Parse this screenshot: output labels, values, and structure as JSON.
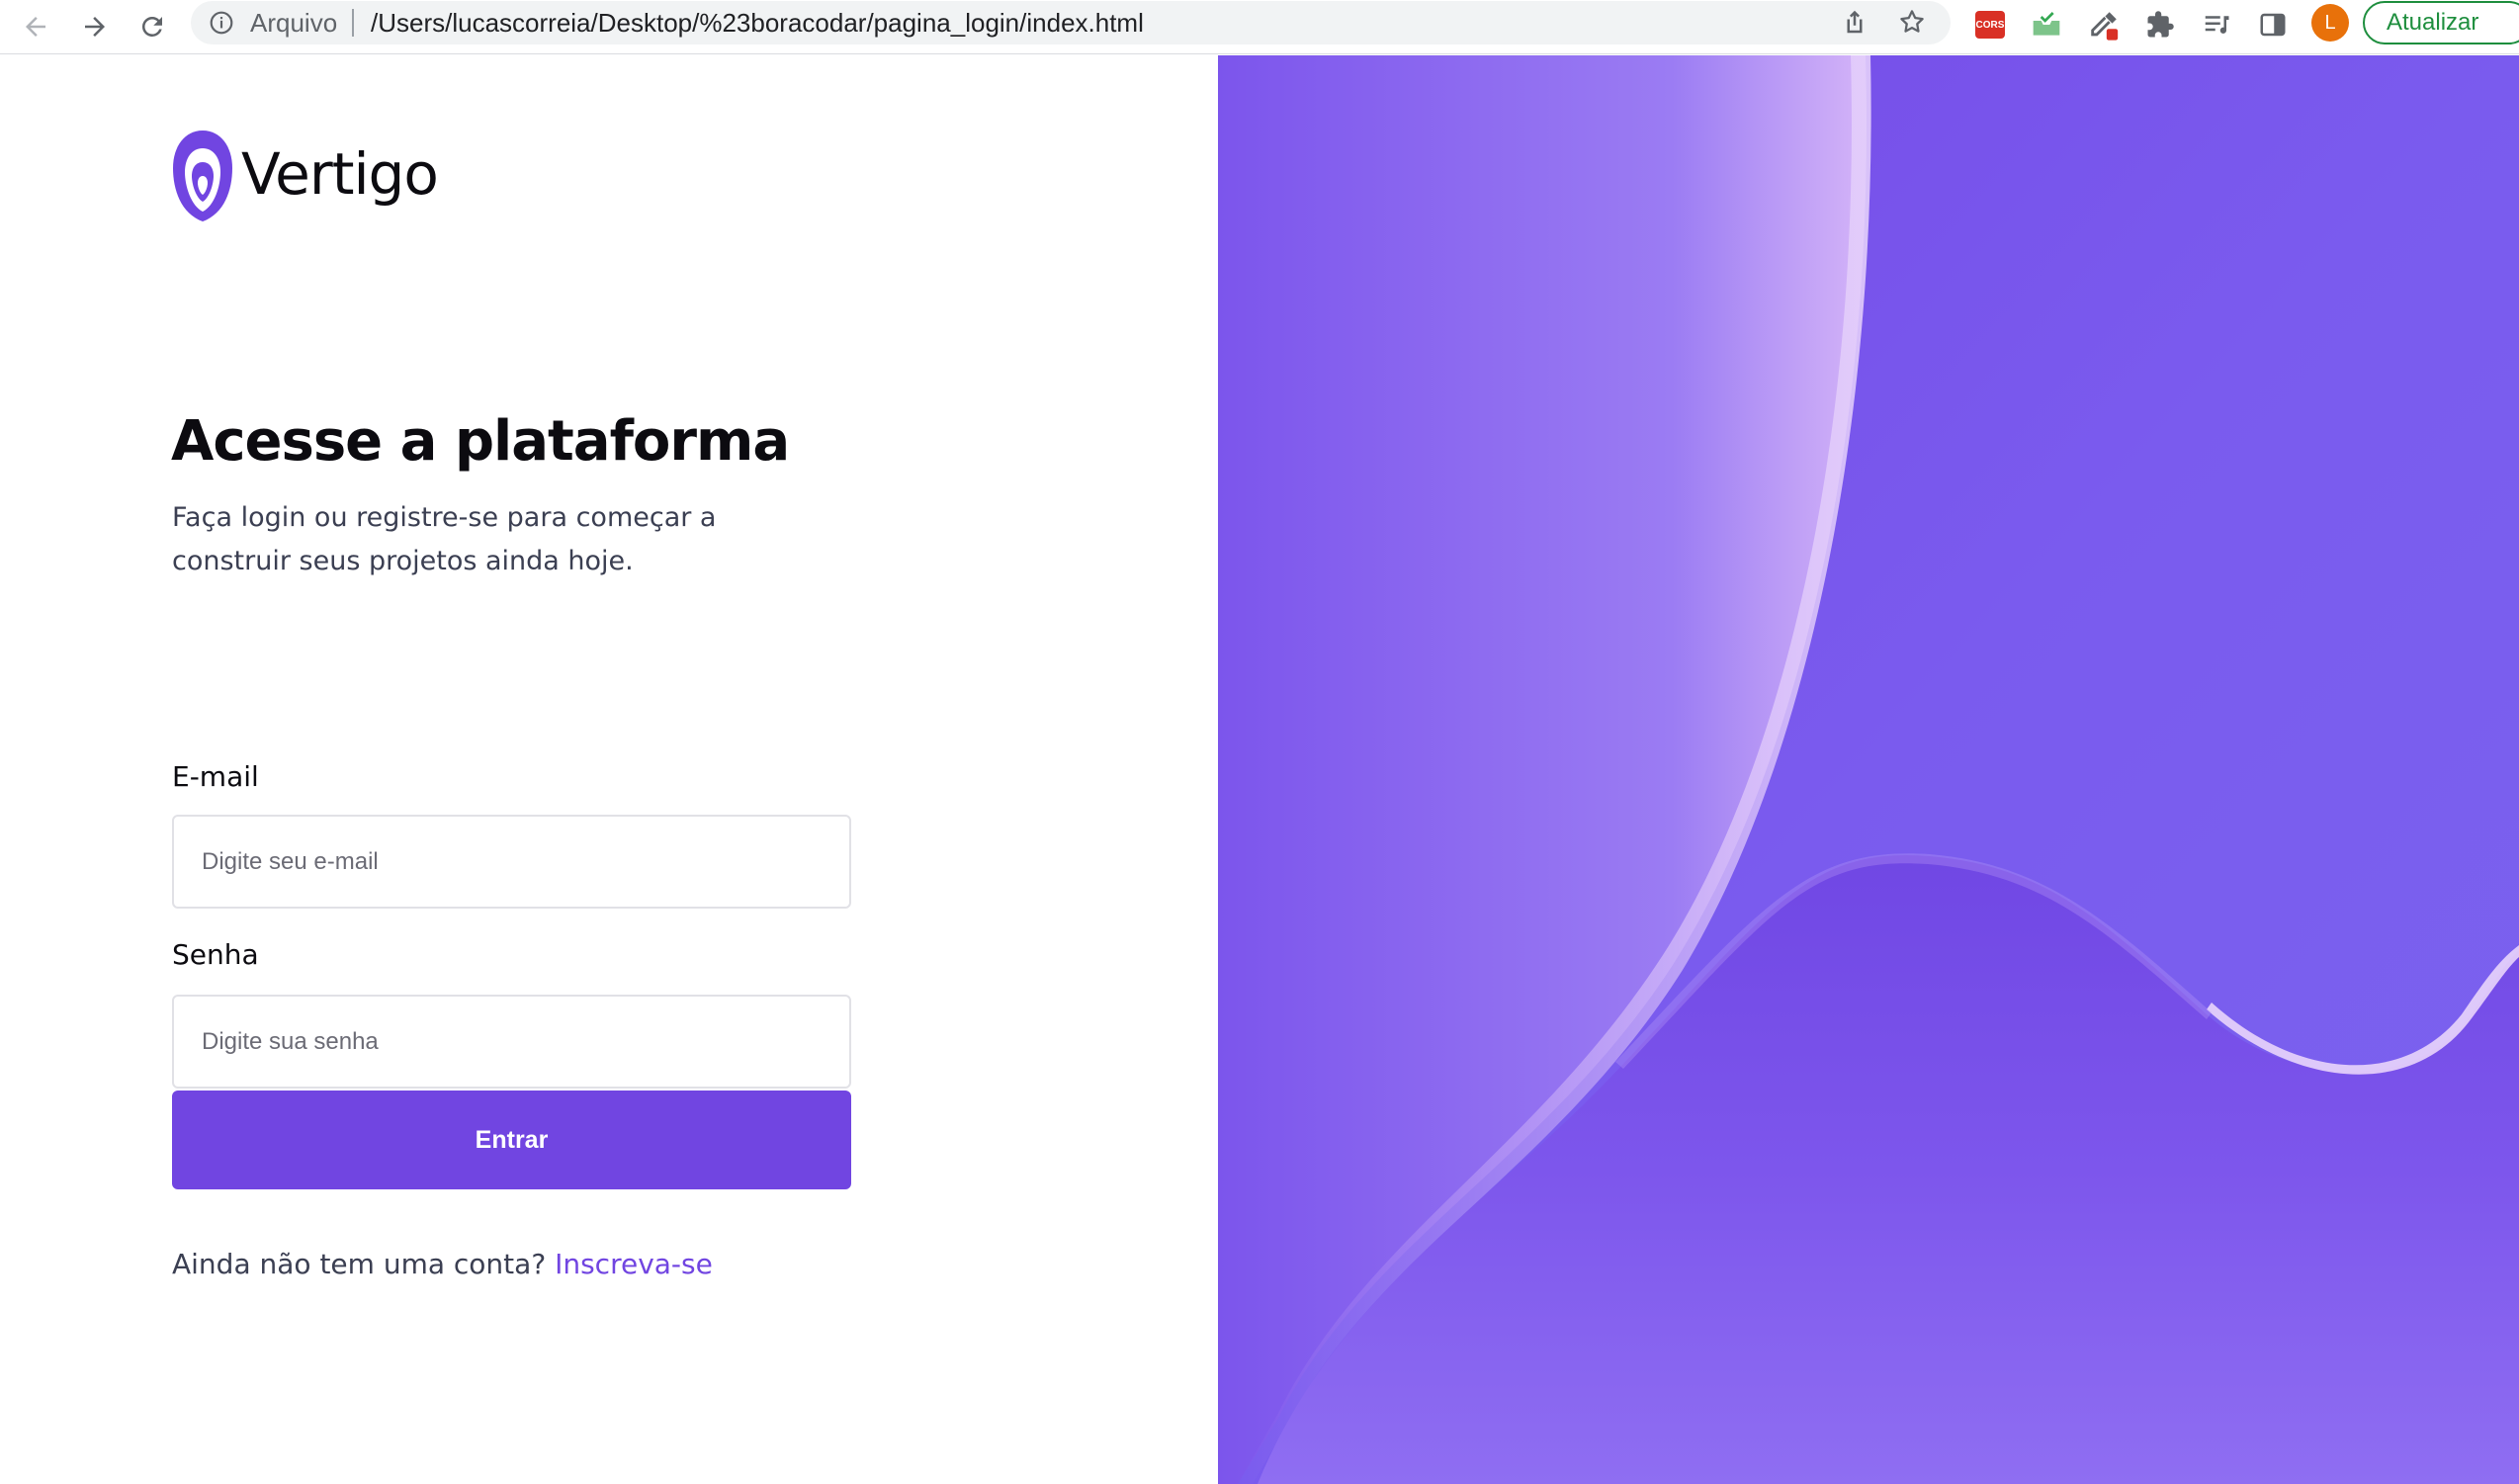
{
  "browser": {
    "scheme_label": "Arquivo",
    "url": "/Users/lucascorreia/Desktop/%23boracodar/pagina_login/index.html",
    "update_label": "Atualizar",
    "avatar_initial": "L",
    "extensions": [
      "cors-extension-icon",
      "inbox-check-extension-icon",
      "eyedropper-extension-icon",
      "puzzle-extensions-icon",
      "reading-list-icon",
      "side-panel-icon"
    ],
    "cors_badge_text": "CORS"
  },
  "brand": {
    "name": "Vertigo",
    "logo_color": "#7145e1"
  },
  "login": {
    "heading": "Acesse a plataforma",
    "subtitle": "Faça login ou registre-se para começar a construir seus projetos ainda hoje.",
    "email_label": "E-mail",
    "email_placeholder": "Digite seu e-mail",
    "email_value": "",
    "password_label": "Senha",
    "password_placeholder": "Digite sua senha",
    "password_value": "",
    "submit_label": "Entrar",
    "signup_prompt": "Ainda não tem uma conta?",
    "signup_link": "Inscreva-se"
  },
  "colors": {
    "accent": "#7145e1",
    "panel_base": "#7650ea",
    "panel_highlight": "#c9a8f7"
  }
}
